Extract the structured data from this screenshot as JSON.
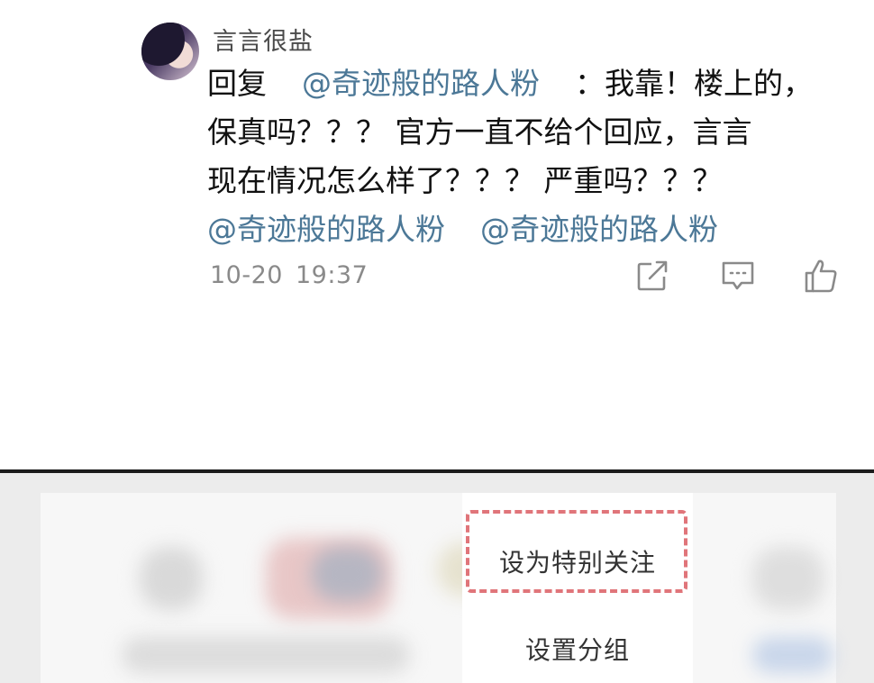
{
  "comment": {
    "username": "言言很盐",
    "reply_prefix": "回复",
    "reply_to": "@奇迹般的路人粉",
    "line1_text": "：我靠！楼上的，",
    "line2_text": "保真吗？？？ 官方一直不给个回应，言言",
    "line3_text": "现在情况怎么样了？？？ 严重吗？？？",
    "mentions": [
      "@奇迹般的路人粉",
      "@奇迹般的路人粉"
    ],
    "date": "10-20",
    "time": "19:37",
    "actions": [
      "share-icon",
      "comment-icon",
      "like-icon"
    ]
  },
  "menu": {
    "items": [
      "设为特别关注",
      "设置分组"
    ],
    "highlight_color": "#e0757a"
  },
  "colors": {
    "mention": "#4c7897",
    "divider": "#1c1c1c"
  }
}
